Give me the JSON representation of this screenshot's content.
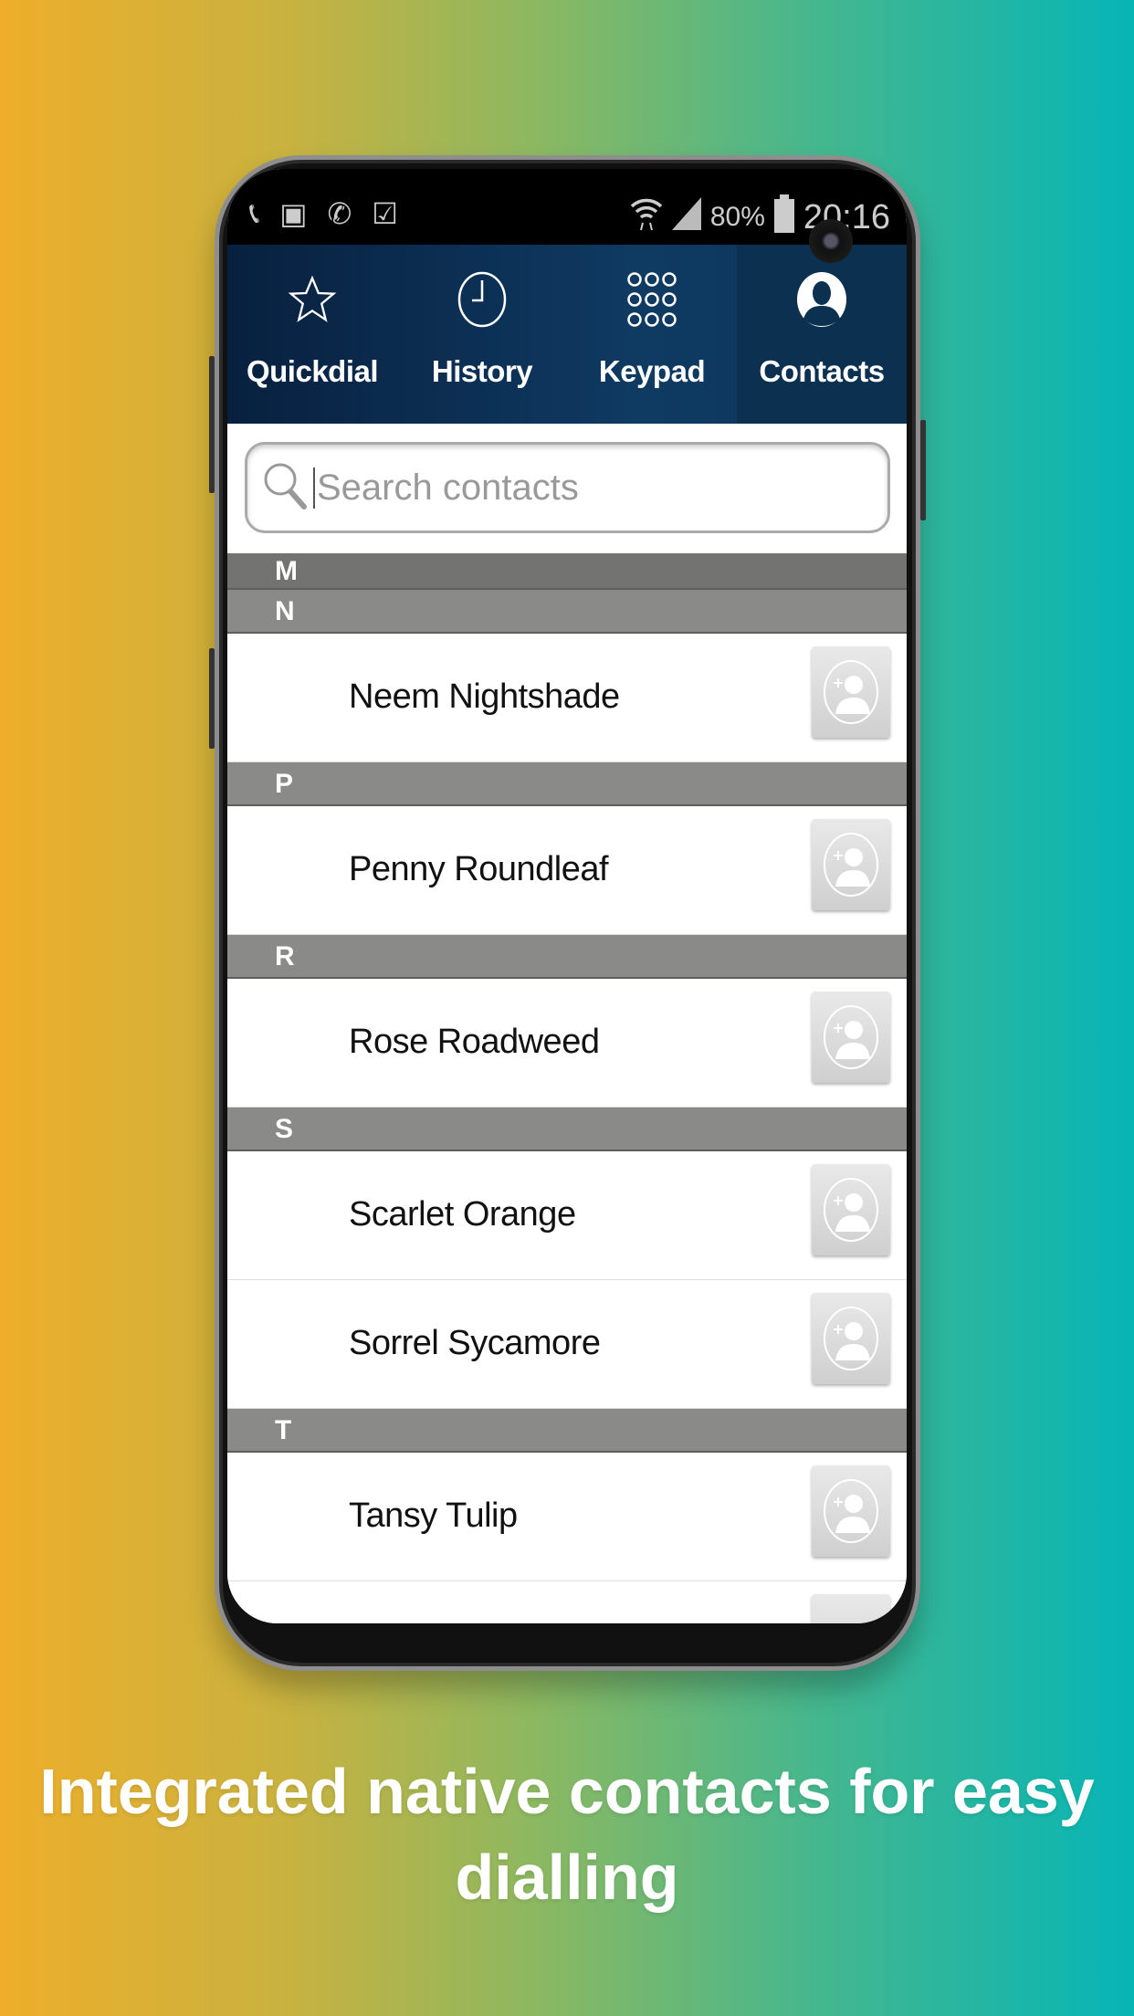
{
  "status_bar": {
    "battery": "80%",
    "time": "20:16",
    "left_icons": [
      "phone-icon",
      "image-icon",
      "missed-call-icon",
      "clipboard-check-icon"
    ],
    "right_icons": [
      "wifi-icon",
      "signal-icon",
      "battery-icon"
    ]
  },
  "tabs": [
    {
      "label": "Quickdial",
      "icon": "star-icon",
      "active": false
    },
    {
      "label": "History",
      "icon": "clock-icon",
      "active": false
    },
    {
      "label": "Keypad",
      "icon": "keypad-icon",
      "active": false
    },
    {
      "label": "Contacts",
      "icon": "person-icon",
      "active": true
    }
  ],
  "search": {
    "placeholder": "Search contacts",
    "value": ""
  },
  "sections": [
    {
      "letter": "M",
      "contacts": []
    },
    {
      "letter": "N",
      "contacts": [
        "Neem Nightshade"
      ]
    },
    {
      "letter": "P",
      "contacts": [
        "Penny Roundleaf"
      ]
    },
    {
      "letter": "R",
      "contacts": [
        "Rose Roadweed"
      ]
    },
    {
      "letter": "S",
      "contacts": [
        "Scarlet Orange",
        "Sorrel Sycamore"
      ]
    },
    {
      "letter": "T",
      "contacts": [
        "Tansy Tulip"
      ]
    }
  ],
  "caption": "Integrated native contacts for easy dialling"
}
